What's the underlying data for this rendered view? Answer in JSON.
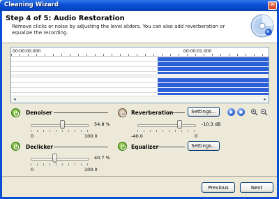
{
  "window": {
    "title": "Cleaning Wizard",
    "close_glyph": "✕"
  },
  "header": {
    "step_title": "Step 4 of 5: Audio Restoration",
    "description": "Remove clicks or noise by adjusting the level sliders. You can also add reverberation or equalize the recording.",
    "icon": "cd-disc-icon"
  },
  "waveform": {
    "time_start": "00:00:00.000",
    "time_mark": "00:00:01.000",
    "selection_color": "#2d5fd6",
    "scroll_left": "◂",
    "scroll_right": "▸"
  },
  "effects": {
    "denoiser": {
      "label": "Denoiser",
      "value": "54.8 %",
      "level": 54.8,
      "min": "0",
      "max": "100.0",
      "enabled": true
    },
    "declicker": {
      "label": "Declicker",
      "value": "40.7 %",
      "level": 40.7,
      "min": "0",
      "max": "100.0",
      "enabled": true
    },
    "reverberation": {
      "label": "Reverberation",
      "value": "-10.3 dB",
      "level": -10.3,
      "min": "-40.0",
      "max": "0",
      "enabled": false,
      "settings_label": "Settings..."
    },
    "equalizer": {
      "label": "Equalizer",
      "enabled": true,
      "settings_label": "Settings..."
    }
  },
  "footer": {
    "previous_label": "Previous",
    "next_label": "Next"
  },
  "colors": {
    "accent": "#0b4ed6",
    "power_on": "#4f9a18",
    "power_off": "#a58c70"
  }
}
